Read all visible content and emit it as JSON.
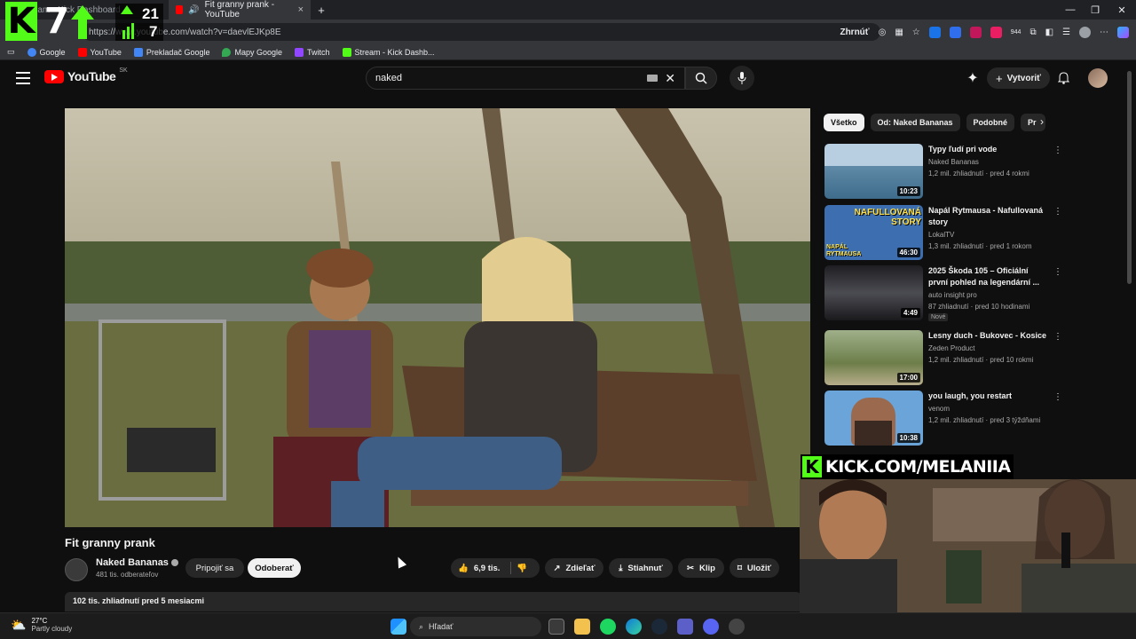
{
  "browser": {
    "tabs": [
      {
        "title": "Stream - Kick Dashboard"
      },
      {
        "title": "Fit granny prank - YouTube"
      }
    ],
    "new_tab_symbol": "+",
    "close_symbol": "×",
    "url": "https://www.youtube.com/watch?v=daevlEJKp8E",
    "summarize_label": "Zhrnúť",
    "ext_badge": "944",
    "bookmarks": [
      {
        "label": "Google",
        "color": "#4285f4"
      },
      {
        "label": "YouTube",
        "color": "#ff0000"
      },
      {
        "label": "Prekladač Google",
        "color": "#4285f4"
      },
      {
        "label": "Mapy Google",
        "color": "#34a853"
      },
      {
        "label": "Twitch",
        "color": "#9146ff"
      },
      {
        "label": "Stream - Kick Dashb...",
        "color": "#53fc18"
      }
    ]
  },
  "stream_overlay": {
    "logo": "K",
    "followers": "7",
    "stat_top": "21",
    "stat_bottom": "7"
  },
  "youtube": {
    "logo_text": "YouTube",
    "region": "SK",
    "search_query": "naked",
    "create_label": "Vytvoriť",
    "video": {
      "title": "Fit granny prank",
      "channel": "Naked Bananas",
      "subscribers": "481 tis. odberateľov",
      "join_label": "Pripojiť sa",
      "subscribe_label": "Odoberať",
      "likes": "6,9 tis.",
      "share_label": "Zdieľať",
      "download_label": "Stiahnuť",
      "clip_label": "Klip",
      "save_label": "Uložiť",
      "views_date": "102 tis. zhliadnutí  pred 5 mesiacmi"
    },
    "chips": [
      "Všetko",
      "Od: Naked Bananas",
      "Podobné",
      "Pr"
    ],
    "recommendations": [
      {
        "title": "Typy ľudí pri vode",
        "channel": "Naked Bananas",
        "meta": "1,2 mil. zhliadnutí · pred 4 rokmi",
        "duration": "10:23",
        "color": "#5f8aa8"
      },
      {
        "title": "Napál Rytmausa - Nafullovaná story",
        "channel": "LokalTV",
        "meta": "1,3 mil. zhliadnutí · pred 1 rokom",
        "duration": "46:30",
        "color": "#3d6fb0"
      },
      {
        "title": "2025 Škoda 105 – Oficiální první pohled na legendární ...",
        "channel": "auto insight pro",
        "meta": "87 zhliadnutí · pred 10 hodinami",
        "badge": "Nové",
        "duration": "4:49",
        "color": "#2a2a2e"
      },
      {
        "title": "Lesny duch - Bukovec - Kosice",
        "channel": "Zeden Product",
        "meta": "1,2 mil. zhliadnutí · pred 10 rokmi",
        "duration": "17:00",
        "color": "#6d7e4a"
      },
      {
        "title": "you laugh, you restart",
        "channel": "venom",
        "meta": "1,2 mil. zhliadnutí · pred 3 týždňami",
        "duration": "10:38",
        "color": "#6aa4d8"
      }
    ],
    "thumb_text": {
      "nafullovana": "NAFULLOVANÁ STORY",
      "rytmausa": "NAPÁL RYTMAUSA"
    }
  },
  "webcam": {
    "banner_logo": "K",
    "banner_text": "KICK.COM/MELANIIA"
  },
  "taskbar": {
    "temperature": "27°C",
    "weather": "Partly cloudy",
    "search_placeholder": "Hľadať"
  }
}
